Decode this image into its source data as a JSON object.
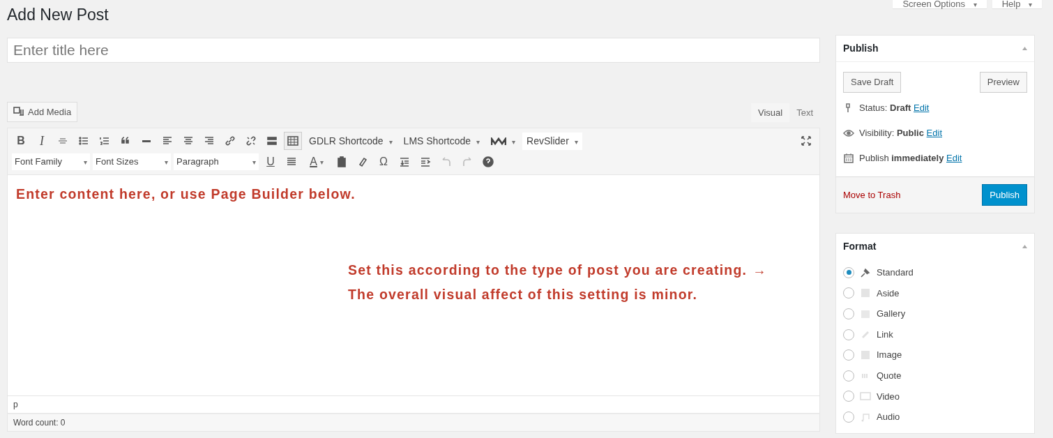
{
  "page_title": "Add New Post",
  "header_tabs": [
    {
      "label": "Screen Options",
      "arrow": "▾"
    },
    {
      "label": "Help",
      "arrow": "▾"
    }
  ],
  "title_field": {
    "placeholder": "Enter title here"
  },
  "add_media_button": "Add Media",
  "editor_tabs": [
    {
      "label": "Visual",
      "selected": true
    },
    {
      "label": "Text",
      "selected": false
    }
  ],
  "toolbar": {
    "bold": "B",
    "italic": "I",
    "dropdowns": [
      {
        "label": "GDLR Shortcode"
      },
      {
        "label": "LMS Shortcode"
      },
      {
        "label": "RevSlider"
      }
    ],
    "selects": [
      {
        "label": "Font Family"
      },
      {
        "label": "Font Sizes"
      },
      {
        "label": "Paragraph"
      }
    ],
    "underline": "U",
    "text_color": "A",
    "special_char": "Ω"
  },
  "content_hint": "Enter content here, or use Page Builder below.",
  "format_note": {
    "lines": [
      "Set this according to the type of post you are creating.",
      "The overall visual affect of this setting is minor."
    ],
    "arrow": "→"
  },
  "path": "p",
  "word_count": "Word count: 0",
  "publish_box": {
    "title": "Publish",
    "save_draft": "Save Draft",
    "preview": "Preview",
    "meta": [
      {
        "kind": "status",
        "text": "Status: **Draft**",
        "link": "Edit"
      },
      {
        "kind": "visibility",
        "text": "Visibility: **Public**",
        "link": "Edit"
      },
      {
        "kind": "schedule",
        "text": "Publish **immediately**",
        "link": "Edit"
      }
    ],
    "trash": "Move to Trash",
    "publish": "Publish"
  },
  "format_box": {
    "title": "Format",
    "options": [
      {
        "kind": "standard",
        "label": "Standard",
        "selected": true
      },
      {
        "kind": "aside",
        "label": "Aside",
        "selected": false
      },
      {
        "kind": "gallery",
        "label": "Gallery",
        "selected": false
      },
      {
        "kind": "link",
        "label": "Link",
        "selected": false
      },
      {
        "kind": "image",
        "label": "Image",
        "selected": false
      },
      {
        "kind": "quote",
        "label": "Quote",
        "selected": false
      },
      {
        "kind": "video",
        "label": "Video",
        "selected": false
      },
      {
        "kind": "audio",
        "label": "Audio",
        "selected": false
      }
    ]
  }
}
